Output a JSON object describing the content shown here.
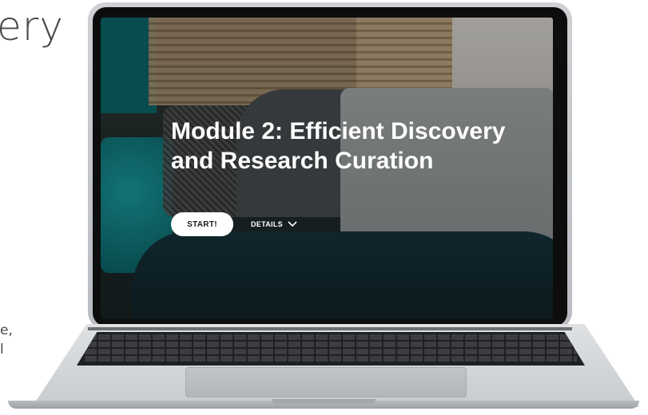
{
  "background_slide": {
    "heading_fragment": "ery",
    "body_fragment_lines": [
      "e,",
      "l"
    ]
  },
  "screen": {
    "module_title": "Module 2: Efficient Discovery and Research Curation",
    "start_button_label": "START!",
    "details_button_label": "DETAILS",
    "details_icon": "chevron-down-icon"
  },
  "colors": {
    "title_text": "#ffffff",
    "start_button_bg": "#ffffff",
    "start_button_text": "#1b1b1b",
    "teal_accent": "#0c6a6d"
  }
}
